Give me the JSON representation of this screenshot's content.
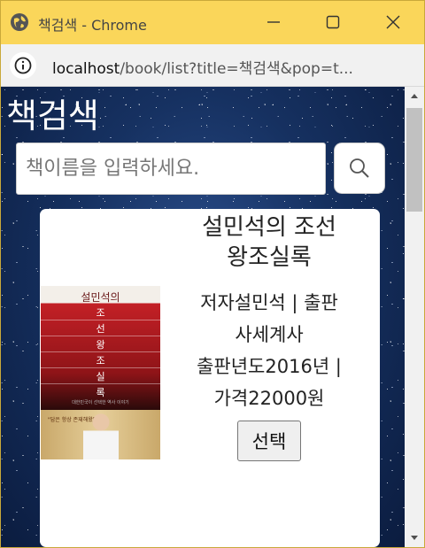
{
  "window": {
    "title": "책검색 - Chrome"
  },
  "address": {
    "host": "localhost",
    "path": "/book/list?title=책검색&pop=t..."
  },
  "page": {
    "title": "책검색",
    "search_placeholder": "책이름을 입력하세요."
  },
  "book": {
    "title_line1": "설민석의 조선",
    "title_line2": "왕조실록",
    "meta_line1": "저자설민석 | 출판",
    "meta_line2": "사세계사",
    "meta_line3": "출판년도2016년 |",
    "meta_line4": "가격22000원",
    "select_label": "선택",
    "cover": {
      "author": "설민석의",
      "chars": [
        "조",
        "선",
        "왕",
        "조",
        "실",
        "록"
      ],
      "subtitle": "대한민국이 선택한 역사 이야기",
      "quote": "\"답은 항상 존재해왔다!\""
    }
  },
  "colors": {
    "titlebar": "#fad65a",
    "background": "#163161"
  },
  "icons": {
    "favicon": "globe-icon",
    "info": "info-icon",
    "search": "search-icon"
  }
}
